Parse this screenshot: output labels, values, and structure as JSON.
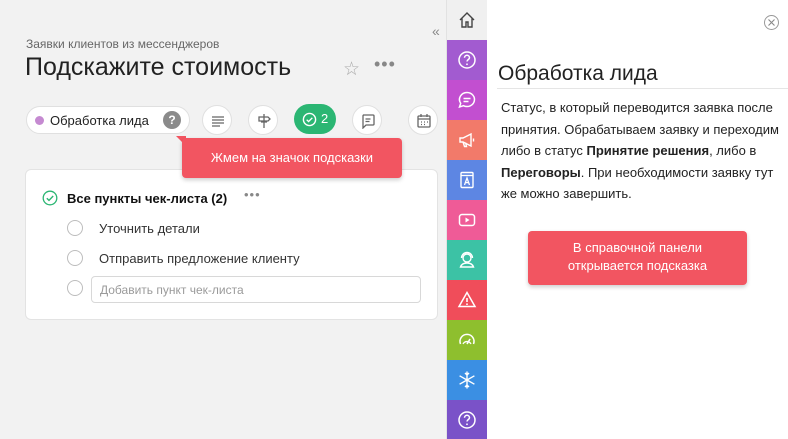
{
  "header": {
    "subtitle": "Заявки клиентов из мессенджеров",
    "title": "Подскажите стоимость",
    "more": "•••",
    "collapse": "«"
  },
  "toolbar": {
    "status_label": "Обработка лида",
    "status_color": "#c58ad1",
    "help_glyph": "?",
    "checklist_count": "2"
  },
  "tooltips": {
    "hint_icon": "Жмем на значок подсказки",
    "panel_hint_line1": "В справочной панели",
    "panel_hint_line2": "открывается подсказка"
  },
  "checklist": {
    "header": "Все пункты чек-листа (2)",
    "more": "•••",
    "items": [
      {
        "label": "Уточнить детали"
      },
      {
        "label": "Отправить предложение клиенту"
      }
    ],
    "add_placeholder": "Добавить пункт чек-листа"
  },
  "panel": {
    "title": "Обработка лида",
    "text_part1": "Статус, в который переводится заявка после принятия. Обрабатываем заявку и переходим либо в статус ",
    "bold1": "Принятие решения",
    "text_part2": ", либо в ",
    "bold2": "Переговоры",
    "text_part3": ". При необходимости заявку тут же можно завершить."
  },
  "rail": [
    {
      "icon": "home-icon",
      "color": "#f0f0f0"
    },
    {
      "icon": "help-icon",
      "color": "#a25bd0"
    },
    {
      "icon": "chat-icon",
      "color": "#c24fd0"
    },
    {
      "icon": "megaphone-icon",
      "color": "#f27a6a"
    },
    {
      "icon": "book-icon",
      "color": "#5d86e3"
    },
    {
      "icon": "video-icon",
      "color": "#ef5b97"
    },
    {
      "icon": "support-icon",
      "color": "#3cc2a5"
    },
    {
      "icon": "warning-icon",
      "color": "#f04d5a"
    },
    {
      "icon": "speedometer-icon",
      "color": "#8ebf2e"
    },
    {
      "icon": "snowflake-icon",
      "color": "#3b8fe3"
    },
    {
      "icon": "question-icon",
      "color": "#7a52c8"
    }
  ],
  "accent": "#2bb673",
  "tooltip_color": "#f25561"
}
